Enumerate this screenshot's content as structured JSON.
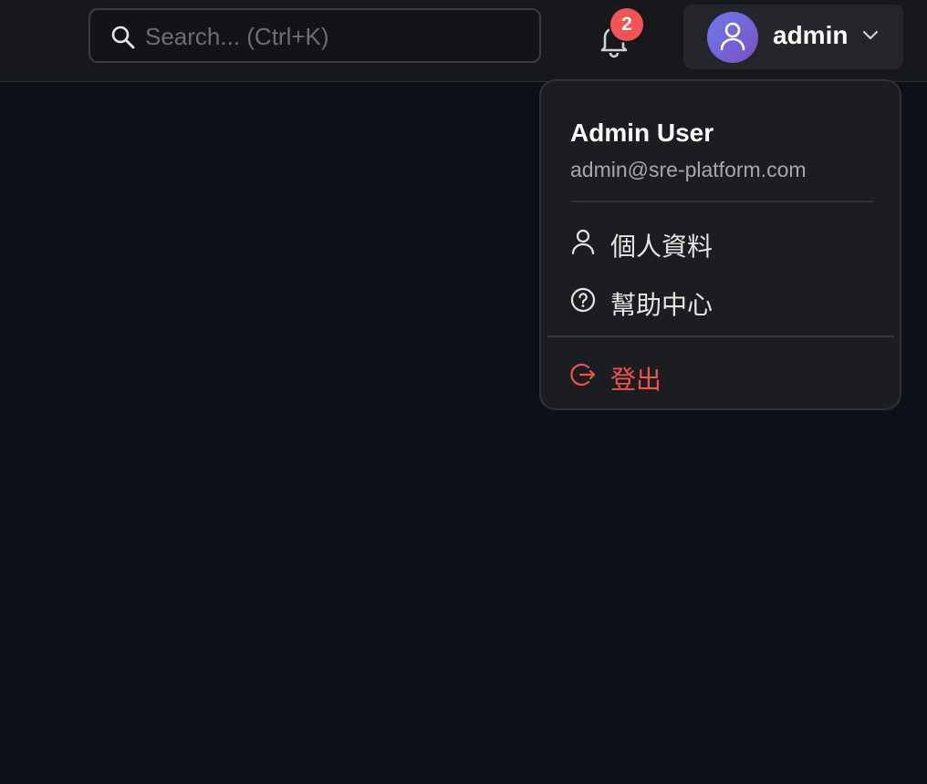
{
  "header": {
    "search": {
      "placeholder": "Search... (Ctrl+K)",
      "value": ""
    },
    "notifications": {
      "icon": "bell-icon",
      "count": "2",
      "badge_color": "#f05454"
    },
    "user": {
      "name": "admin",
      "avatar_icon": "user-icon",
      "dropdown_icon": "chevron-down-icon"
    }
  },
  "user_menu": {
    "full_name": "Admin User",
    "email": "admin@sre-platform.com",
    "items": [
      {
        "label": "個人資料",
        "icon": "user-icon"
      },
      {
        "label": "幫助中心",
        "icon": "help-circle-icon"
      }
    ],
    "logout": {
      "label": "登出",
      "icon": "logout-icon",
      "color": "#ef5350"
    }
  },
  "colors": {
    "background": "#0d1117",
    "topbar": "#17181c",
    "menu_background": "#1c1d21",
    "accent_gradient_start": "#6d7bf0",
    "accent_gradient_end": "#7c4fc0"
  }
}
